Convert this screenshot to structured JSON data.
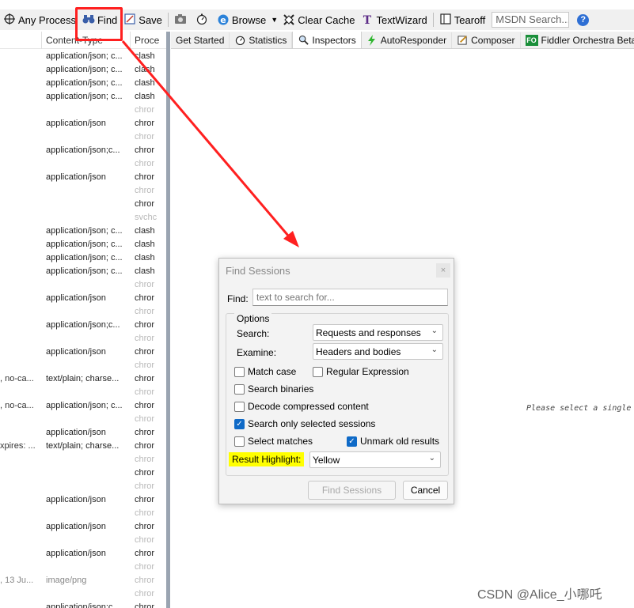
{
  "toolbar": {
    "any_process": "Any Process",
    "find": "Find",
    "save": "Save",
    "browse": "Browse",
    "clear_cache": "Clear Cache",
    "textwizard": "TextWizard",
    "tearoff": "Tearoff",
    "msdn_search": "MSDN Search..."
  },
  "sessions": {
    "headers": {
      "content_type": "Content-Type",
      "process": "Proce"
    },
    "rows": [
      {
        "a": "",
        "ct": "application/json; c...",
        "p": "clash",
        "dim": false
      },
      {
        "a": "",
        "ct": "application/json; c...",
        "p": "clash",
        "dim": false
      },
      {
        "a": "",
        "ct": "application/json; c...",
        "p": "clash",
        "dim": false
      },
      {
        "a": "",
        "ct": "application/json; c...",
        "p": "clash",
        "dim": false
      },
      {
        "a": "",
        "ct": "",
        "p": "chror",
        "dim": true
      },
      {
        "a": "",
        "ct": "application/json",
        "p": "chror",
        "dim": false
      },
      {
        "a": "",
        "ct": "",
        "p": "chror",
        "dim": true
      },
      {
        "a": "",
        "ct": "application/json;c...",
        "p": "chror",
        "dim": false
      },
      {
        "a": "",
        "ct": "",
        "p": "chror",
        "dim": true
      },
      {
        "a": "",
        "ct": "application/json",
        "p": "chror",
        "dim": false
      },
      {
        "a": "",
        "ct": "",
        "p": "chror",
        "dim": true
      },
      {
        "a": "",
        "ct": "",
        "p": "chror",
        "dim": false
      },
      {
        "a": "",
        "ct": "",
        "p": "svchc",
        "dim": true
      },
      {
        "a": "",
        "ct": "application/json; c...",
        "p": "clash",
        "dim": false
      },
      {
        "a": "",
        "ct": "application/json; c...",
        "p": "clash",
        "dim": false
      },
      {
        "a": "",
        "ct": "application/json; c...",
        "p": "clash",
        "dim": false
      },
      {
        "a": "",
        "ct": "application/json; c...",
        "p": "clash",
        "dim": false
      },
      {
        "a": "",
        "ct": "",
        "p": "chror",
        "dim": true
      },
      {
        "a": "",
        "ct": "application/json",
        "p": "chror",
        "dim": false
      },
      {
        "a": "",
        "ct": "",
        "p": "chror",
        "dim": true
      },
      {
        "a": "",
        "ct": "application/json;c...",
        "p": "chror",
        "dim": false
      },
      {
        "a": "",
        "ct": "",
        "p": "chror",
        "dim": true
      },
      {
        "a": "",
        "ct": "application/json",
        "p": "chror",
        "dim": false
      },
      {
        "a": "",
        "ct": "",
        "p": "chror",
        "dim": true
      },
      {
        "a": ", no-ca...",
        "ct": "text/plain; charse...",
        "p": "chror",
        "dim": false
      },
      {
        "a": "",
        "ct": "",
        "p": "chror",
        "dim": true
      },
      {
        "a": ", no-ca...",
        "ct": "application/json; c...",
        "p": "chror",
        "dim": false
      },
      {
        "a": "",
        "ct": "",
        "p": "chror",
        "dim": true
      },
      {
        "a": "",
        "ct": "application/json",
        "p": "chror",
        "dim": false
      },
      {
        "a": "xpires: ...",
        "ct": "text/plain; charse...",
        "p": "chror",
        "dim": false
      },
      {
        "a": "",
        "ct": "",
        "p": "chror",
        "dim": true
      },
      {
        "a": "",
        "ct": "",
        "p": "chror",
        "dim": false
      },
      {
        "a": "",
        "ct": "",
        "p": "chror",
        "dim": true
      },
      {
        "a": "",
        "ct": "application/json",
        "p": "chror",
        "dim": false
      },
      {
        "a": "",
        "ct": "",
        "p": "chror",
        "dim": true
      },
      {
        "a": "",
        "ct": "application/json",
        "p": "chror",
        "dim": false
      },
      {
        "a": "",
        "ct": "",
        "p": "chror",
        "dim": true
      },
      {
        "a": "",
        "ct": "application/json",
        "p": "chror",
        "dim": false
      },
      {
        "a": "",
        "ct": "",
        "p": "chror",
        "dim": true
      },
      {
        "a": ", 13 Ju...",
        "ct": "image/png",
        "p": "chror",
        "dim": true
      },
      {
        "a": "",
        "ct": "",
        "p": "chror",
        "dim": true
      },
      {
        "a": "",
        "ct": "application/json;c...",
        "p": "chror",
        "dim": false
      }
    ]
  },
  "tabs": {
    "get_started": "Get Started",
    "statistics": "Statistics",
    "inspectors": "Inspectors",
    "autoresponder": "AutoResponder",
    "composer": "Composer",
    "fo_badge": "FO",
    "orchestra": "Fiddler Orchestra Beta"
  },
  "content": {
    "select_message": "Please select a single"
  },
  "dialog": {
    "title": "Find Sessions",
    "close": "×",
    "find_label": "Find:",
    "find_placeholder": "text to search for...",
    "options_legend": "Options",
    "search_label": "Search:",
    "search_value": "Requests and responses",
    "examine_label": "Examine:",
    "examine_value": "Headers and bodies",
    "match_case": "Match case",
    "regex": "Regular Expression",
    "search_binaries": "Search binaries",
    "decode": "Decode compressed content",
    "selected_only": "Search only selected sessions",
    "select_matches": "Select matches",
    "unmark_old": "Unmark old results",
    "highlight_label": "Result Highlight:",
    "highlight_value": "Yellow",
    "find_button": "Find Sessions",
    "cancel_button": "Cancel"
  },
  "watermark": "CSDN @Alice_小哪吒",
  "colors": {
    "annotation": "#ff2020",
    "highlight": "#ffff00",
    "checkbox_on": "#0f6ac7"
  }
}
